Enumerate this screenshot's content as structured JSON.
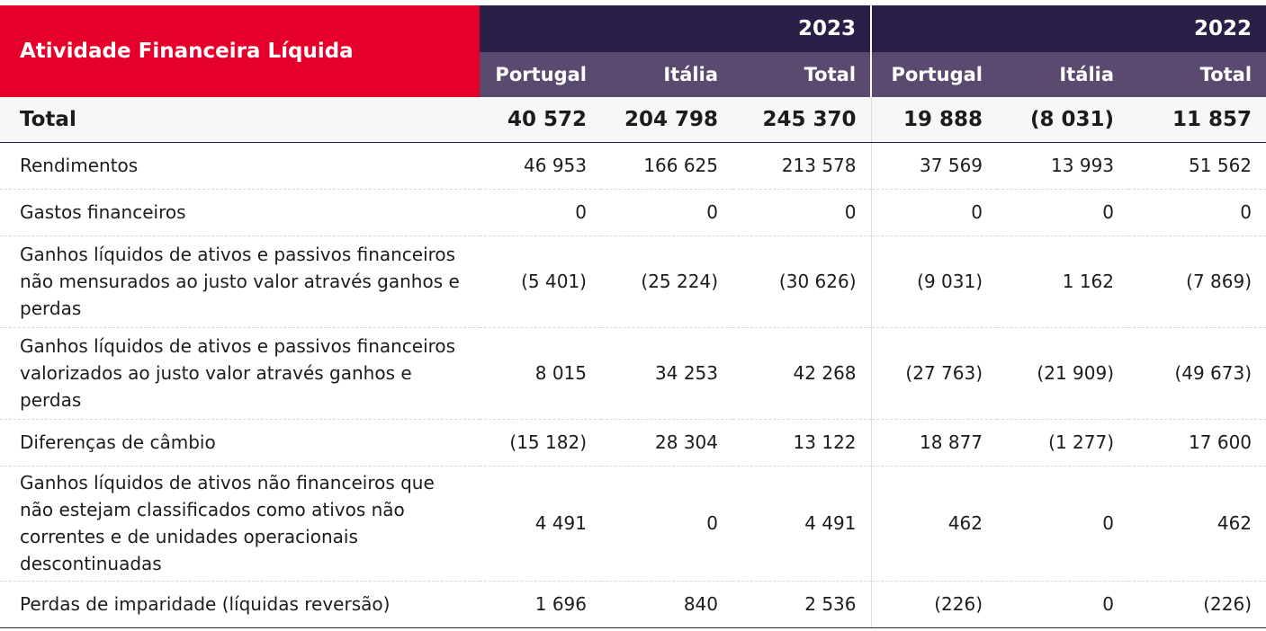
{
  "header": {
    "title": "Atividade Financeira Líquida",
    "years": [
      "2023",
      "2022"
    ],
    "subheaders": [
      "Portugal",
      "Itália",
      "Total",
      "Portugal",
      "Itália",
      "Total"
    ]
  },
  "total": {
    "label": "Total",
    "values": [
      "40 572",
      "204 798",
      "245 370",
      "19 888",
      "(8 031)",
      "11 857"
    ]
  },
  "rows": [
    {
      "label": "Rendimentos",
      "values": [
        "46 953",
        "166 625",
        "213 578",
        "37 569",
        "13 993",
        "51 562"
      ]
    },
    {
      "label": "Gastos financeiros",
      "values": [
        "0",
        "0",
        "0",
        "0",
        "0",
        "0"
      ]
    },
    {
      "label": "Ganhos líquidos de ativos e passivos financeiros não mensurados ao justo valor através ganhos e perdas",
      "values": [
        "(5 401)",
        "(25 224)",
        "(30 626)",
        "(9 031)",
        "1 162",
        "(7 869)"
      ]
    },
    {
      "label": "Ganhos líquidos de ativos e passivos financeiros valorizados ao justo valor através ganhos e perdas",
      "values": [
        "8 015",
        "34 253",
        "42 268",
        "(27 763)",
        "(21 909)",
        "(49 673)"
      ]
    },
    {
      "label": "Diferenças de câmbio",
      "values": [
        "(15 182)",
        "28 304",
        "13 122",
        "18 877",
        "(1 277)",
        "17 600"
      ]
    },
    {
      "label": "Ganhos líquidos de ativos não financeiros que não estejam classificados como ativos não correntes e de unidades operacionais descontinuadas",
      "values": [
        "4 491",
        "0",
        "4 491",
        "462",
        "0",
        "462"
      ]
    },
    {
      "label": "Perdas de imparidade (líquidas reversão)",
      "values": [
        "1 696",
        "840",
        "2 536",
        "(226)",
        "0",
        "(226)"
      ]
    }
  ]
}
